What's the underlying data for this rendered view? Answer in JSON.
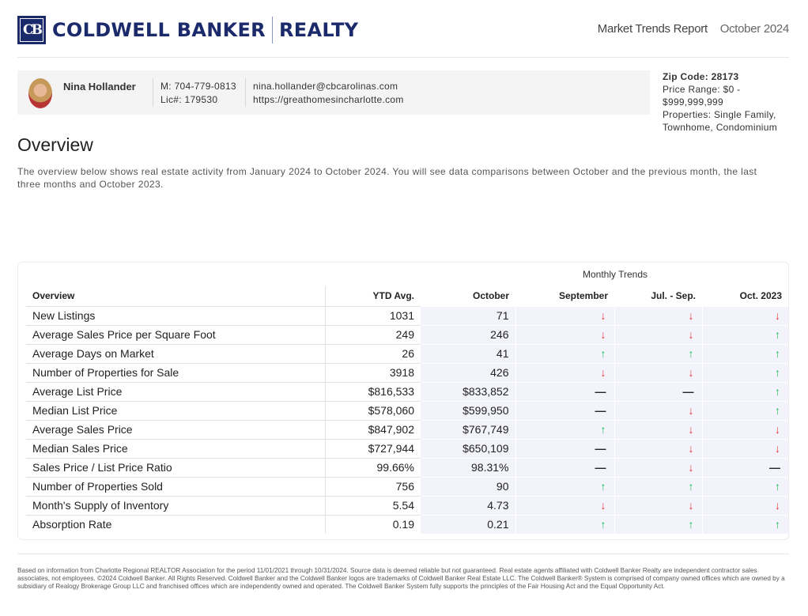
{
  "header": {
    "brand_monogram": "CB",
    "brand_name": "COLDWELL BANKER",
    "brand_suffix": "REALTY",
    "report_title": "Market Trends Report",
    "report_period": "October 2024",
    "brand_color": "#1b2a6b"
  },
  "agent": {
    "name": "Nina Hollander",
    "mobile": "M: 704-779-0813",
    "license": "Lic#: 179530",
    "email": "nina.hollander@cbcarolinas.com",
    "website": "https://greathomesincharlotte.com"
  },
  "filters": {
    "zip": "Zip Code: 28173",
    "price_range": "Price Range: $0 - $999,999,999",
    "properties": "Properties: Single Family, Townhome, Condominium"
  },
  "overview": {
    "title": "Overview",
    "description": "The overview below shows real estate activity from January 2024 to October 2024. You will see data comparisons between October and the previous month, the last three months and October 2023."
  },
  "table": {
    "group_header": "Monthly Trends",
    "columns": [
      "Overview",
      "YTD Avg.",
      "October",
      "September",
      "Jul. - Sep.",
      "Oct. 2023"
    ],
    "trend_colors": {
      "up": "#1fbf5b",
      "down": "#e53b3b",
      "flat": "#222222"
    },
    "rows": [
      {
        "metric": "New Listings",
        "ytd": "1031",
        "october": "71",
        "september": "down",
        "q3": "down",
        "prev_year": "down"
      },
      {
        "metric": "Average Sales Price per Square Foot",
        "ytd": "249",
        "october": "246",
        "september": "down",
        "q3": "down",
        "prev_year": "up"
      },
      {
        "metric": "Average Days on Market",
        "ytd": "26",
        "october": "41",
        "september": "up",
        "q3": "up",
        "prev_year": "up"
      },
      {
        "metric": "Number of Properties for Sale",
        "ytd": "3918",
        "october": "426",
        "september": "down",
        "q3": "down",
        "prev_year": "up"
      },
      {
        "metric": "Average List Price",
        "ytd": "$816,533",
        "october": "$833,852",
        "september": "flat",
        "q3": "flat",
        "prev_year": "up"
      },
      {
        "metric": "Median List Price",
        "ytd": "$578,060",
        "october": "$599,950",
        "september": "flat",
        "q3": "down",
        "prev_year": "up"
      },
      {
        "metric": "Average Sales Price",
        "ytd": "$847,902",
        "october": "$767,749",
        "september": "up",
        "q3": "down",
        "prev_year": "down"
      },
      {
        "metric": "Median Sales Price",
        "ytd": "$727,944",
        "october": "$650,109",
        "september": "flat",
        "q3": "down",
        "prev_year": "down"
      },
      {
        "metric": "Sales Price / List Price Ratio",
        "ytd": "99.66%",
        "october": "98.31%",
        "september": "flat",
        "q3": "down",
        "prev_year": "flat"
      },
      {
        "metric": "Number of Properties Sold",
        "ytd": "756",
        "october": "90",
        "september": "up",
        "q3": "up",
        "prev_year": "up"
      },
      {
        "metric": "Month's Supply of Inventory",
        "ytd": "5.54",
        "october": "4.73",
        "september": "down",
        "q3": "down",
        "prev_year": "down"
      },
      {
        "metric": "Absorption Rate",
        "ytd": "0.19",
        "october": "0.21",
        "september": "up",
        "q3": "up",
        "prev_year": "up"
      }
    ]
  },
  "footer": {
    "disclaimer": "Based on information from Charlotte Regional REALTOR Association for the period 11/01/2021 through 10/31/2024. Source data is deemed reliable but not guaranteed. Real estate agents affiliated with Coldwell Banker Realty are independent contractor sales associates, not employees. ©2024 Coldwell Banker. All Rights Reserved. Coldwell Banker and the Coldwell Banker logos are trademarks of Coldwell Banker Real Estate LLC. The Coldwell Banker® System is comprised of company owned offices which are owned by a subsidiary of Realogy Brokerage Group LLC and franchised offices which are independently owned and operated. The Coldwell Banker System fully supports the principles of the Fair Housing Act and the Equal Opportunity Act."
  }
}
